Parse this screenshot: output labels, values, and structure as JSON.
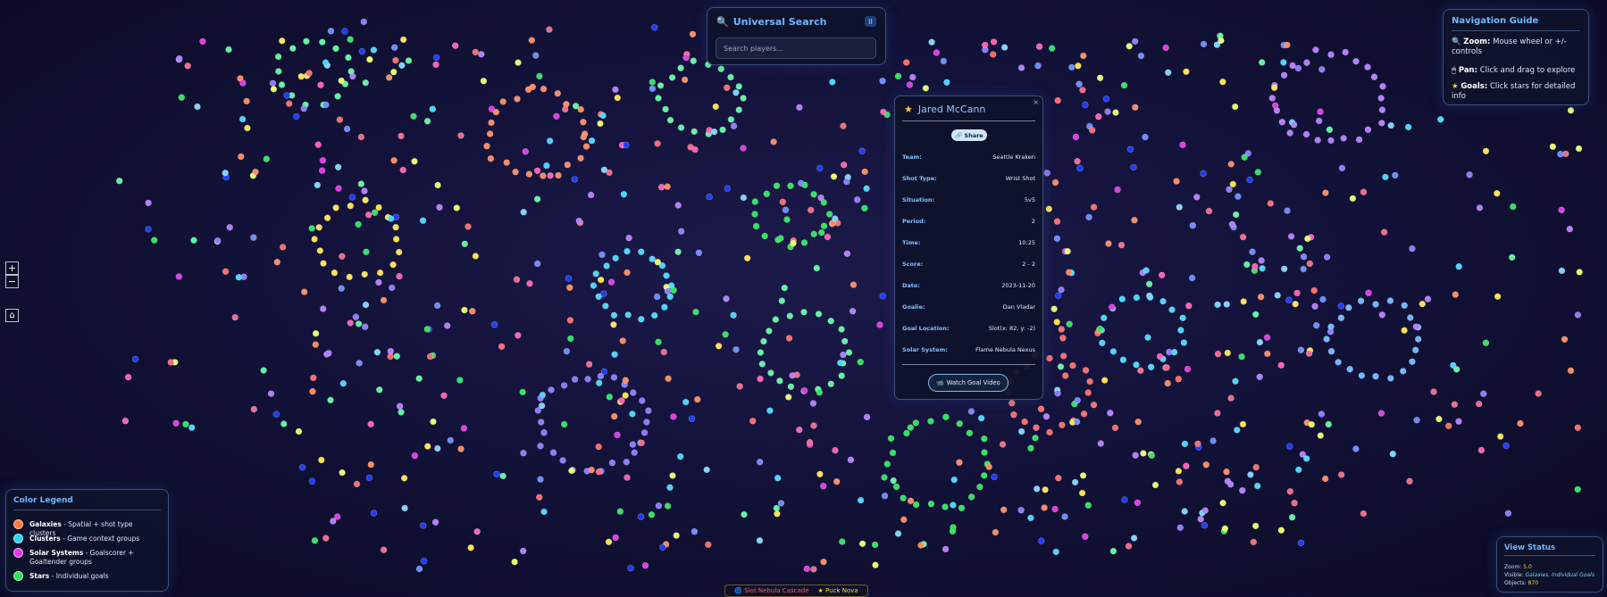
{
  "search": {
    "title": "Universal Search",
    "placeholder": "Search players...",
    "pause_icon": "II"
  },
  "navigation_guide": {
    "title": "Navigation Guide",
    "items": [
      {
        "icon": "magnifier-icon",
        "label": "Zoom:",
        "text": " Mouse wheel or +/- controls"
      },
      {
        "icon": "hand-icon",
        "label": "Pan:",
        "text": " Click and drag to explore"
      },
      {
        "icon": "star-icon",
        "label": "Goals:",
        "text": " Click stars for detailed info"
      }
    ]
  },
  "zoom_controls": {
    "zoom_in": "+",
    "zoom_out": "−",
    "home": "⌂"
  },
  "goal_popup": {
    "close": "×",
    "player_name": "Jared McCann",
    "share_label": "Share",
    "fields": [
      {
        "label": "Team:",
        "value": "Seattle Kraken"
      },
      {
        "label": "Shot Type:",
        "value": "Wrist Shot"
      },
      {
        "label": "Situation:",
        "value": "5v5"
      },
      {
        "label": "Period:",
        "value": "2"
      },
      {
        "label": "Time:",
        "value": "10:25"
      },
      {
        "label": "Score:",
        "value": "2 - 2"
      },
      {
        "label": "Date:",
        "value": "2023-11-20"
      },
      {
        "label": "Goalie:",
        "value": "Dan Vladar"
      },
      {
        "label": "Goal Location:",
        "value": "Slot(x: 82, y: -2)"
      },
      {
        "label": "Solar System:",
        "value": "Flame Nebula Nexus"
      }
    ],
    "video_label": "Watch Goal Video"
  },
  "legend": {
    "title": "Color Legend",
    "items": [
      {
        "name": "Galaxies",
        "desc": " - Spatial + shot type clusters",
        "color": "#ff7a3d"
      },
      {
        "name": "Clusters",
        "desc": " - Game context groups",
        "color": "#29d3f5"
      },
      {
        "name": "Solar Systems",
        "desc": " - Goalscorer + Goaltender groups",
        "color": "#e33be6"
      },
      {
        "name": "Stars",
        "desc": " - Individual goals",
        "color": "#2ee55e"
      }
    ]
  },
  "view_status": {
    "title": "View Status",
    "zoom_label": "Zoom: ",
    "zoom_value": "5.0",
    "visible_label": "Visible: ",
    "visible_value": "Galaxies, Individual Goals",
    "objects_label": "Objects: ",
    "objects_value": "870"
  },
  "bottom_bar": {
    "item1": "Slot Nebula Cascade",
    "item2": "Puck Nova"
  },
  "colors": {
    "accent": "#6fb8ff",
    "star_palette": [
      "#ff6b6b",
      "#ff8a5c",
      "#f16a8a",
      "#ffe14d",
      "#e7ff6a",
      "#2ee55e",
      "#5ef5a0",
      "#48d6ff",
      "#7dd3fc",
      "#6c8cff",
      "#8a7bff",
      "#b47cff",
      "#e33be6",
      "#ff5fb0",
      "#1e3cff"
    ]
  }
}
